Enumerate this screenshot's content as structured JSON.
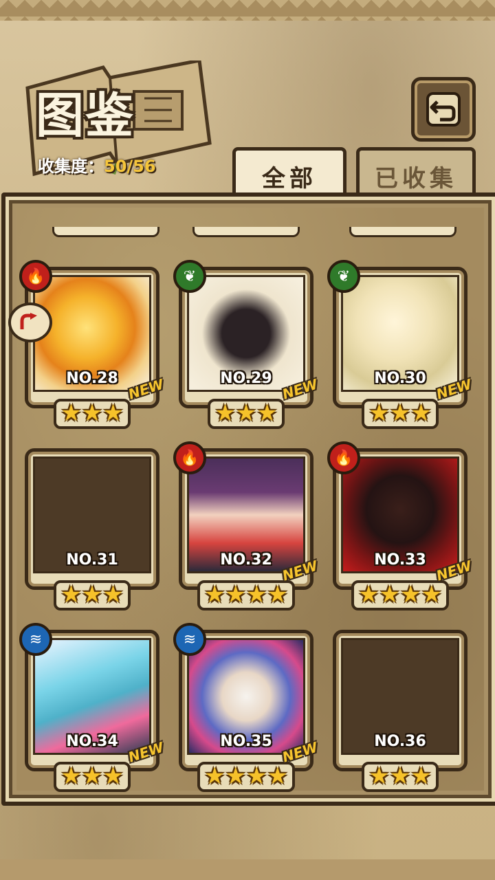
{
  "header": {
    "title": "图鉴",
    "progress_label": "收集度：",
    "progress_value": "50/56"
  },
  "tabs": [
    {
      "label": "全部",
      "active": true
    },
    {
      "label": "已收集",
      "active": false
    }
  ],
  "icons": {
    "back": "back-arrow-icon",
    "side": "curved-arrow-icon",
    "fire": "fire-element-icon",
    "leaf": "leaf-element-icon",
    "water": "water-element-icon"
  },
  "cards": [
    {
      "number": "NO.28",
      "stars": 3,
      "element": "fire",
      "new": "NEW",
      "unlocked": true
    },
    {
      "number": "NO.29",
      "stars": 3,
      "element": "leaf",
      "new": "NEW",
      "unlocked": true
    },
    {
      "number": "NO.30",
      "stars": 3,
      "element": "leaf",
      "new": "NEW",
      "unlocked": true
    },
    {
      "number": "NO.31",
      "stars": 3,
      "element": "",
      "new": "",
      "unlocked": false
    },
    {
      "number": "NO.32",
      "stars": 4,
      "element": "fire",
      "new": "NEW",
      "unlocked": true
    },
    {
      "number": "NO.33",
      "stars": 4,
      "element": "fire",
      "new": "NEW",
      "unlocked": true
    },
    {
      "number": "NO.34",
      "stars": 3,
      "element": "water",
      "new": "NEW",
      "unlocked": true
    },
    {
      "number": "NO.35",
      "stars": 4,
      "element": "water",
      "new": "NEW",
      "unlocked": true
    },
    {
      "number": "NO.36",
      "stars": 3,
      "element": "",
      "new": "",
      "unlocked": false
    }
  ],
  "colors": {
    "accent": "#f5c53a",
    "fire": "#c0201b",
    "leaf": "#2f7a2a",
    "water": "#1d66b4",
    "frame": "#3a2a18"
  }
}
